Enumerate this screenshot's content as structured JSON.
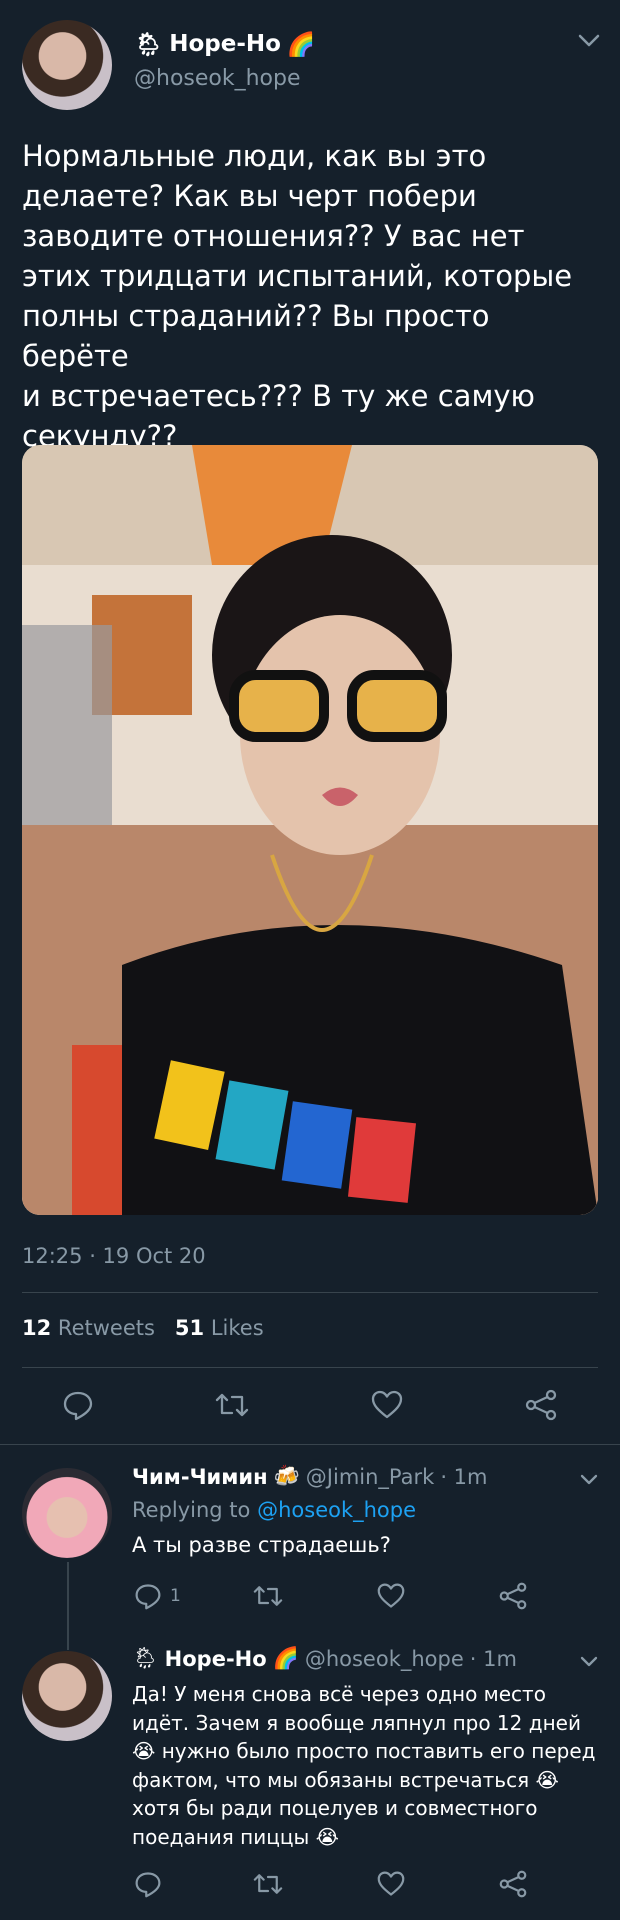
{
  "tweet": {
    "emoji_cloud": "🌦",
    "display_name": "Hope-Ho",
    "emoji_rainbow": "🌈",
    "handle": "@hoseok_hope",
    "text_lines": [
      "Нормальные люди, как вы это",
      "делаете? Как вы черт побери",
      "заводите отношения?? У вас нет",
      "этих тридцати испытаний, которые",
      "полны страданий?? Вы просто берёте",
      "и встречаетесь??? В ту же самую",
      "секунду??"
    ],
    "timestamp": "12:25 · 19 Oct 20",
    "retweets_count": "12",
    "retweets_label": "Retweets",
    "likes_count": "51",
    "likes_label": "Likes"
  },
  "replies": [
    {
      "display_name": "Чим-Чимин",
      "name_emoji": "🍻",
      "handle": "@Jimin_Park",
      "time": "· 1m",
      "replying_prefix": "Replying to",
      "replying_handle": "@hoseok_hope",
      "text_lines": [
        "А ты разве страдаешь?"
      ],
      "reply_count": "1"
    },
    {
      "emoji_cloud": "🌦",
      "display_name": "Hope-Ho",
      "name_emoji": "🌈",
      "handle": "@hoseok_hope",
      "time": "· 1m",
      "text_lines": [
        "Да! У меня снова всё через одно место",
        "идёт. Зачем я вообще ляпнул про 12 дней",
        "😭 нужно было просто поставить его перед",
        "фактом, что мы обязаны встречаться 😭",
        "хотя бы ради поцелуев и совместного",
        "поедания пиццы 😭"
      ]
    }
  ],
  "colors": {
    "background": "#15202b",
    "muted": "#8899a6",
    "link": "#1da1f2",
    "divider": "#38444d"
  },
  "icons": [
    "chevron-down-icon",
    "reply-icon",
    "retweet-icon",
    "like-icon",
    "share-icon"
  ]
}
